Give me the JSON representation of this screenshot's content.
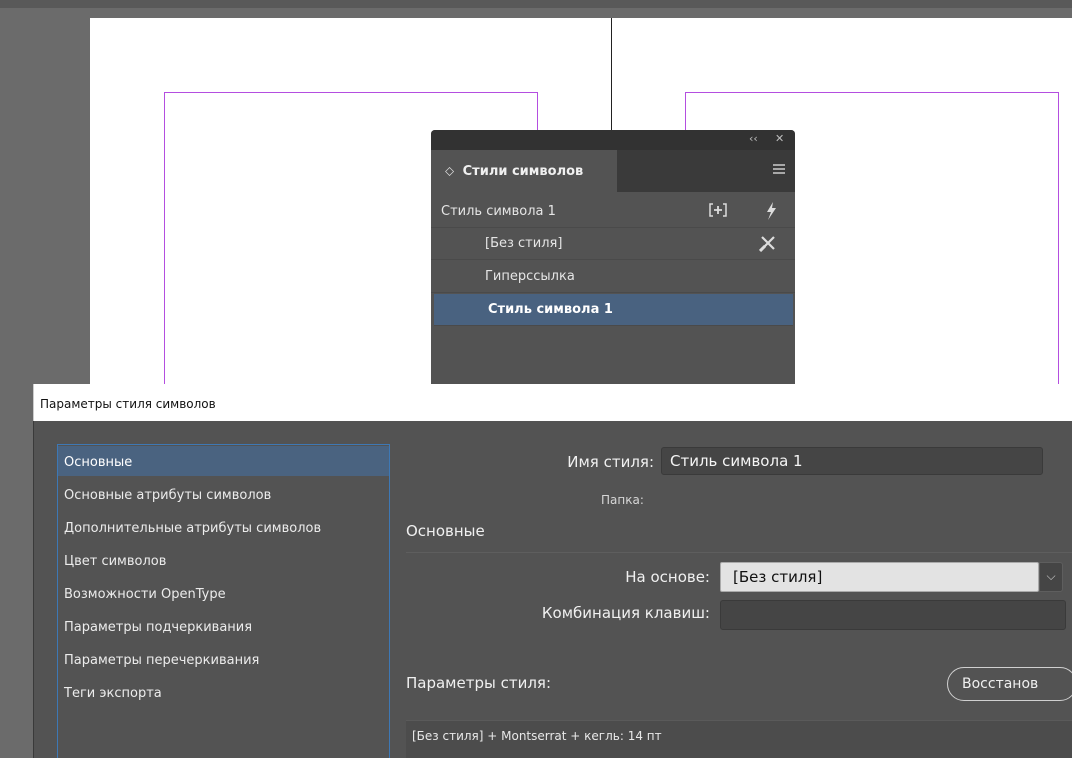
{
  "panel": {
    "controls": {
      "collapse": "‹‹",
      "close": "✕"
    },
    "tab_icon": "⬦",
    "title": "Стили символов",
    "current_style": "Стиль символа 1",
    "items": [
      "[Без стиля]",
      "Гиперссылка",
      "Стиль символа 1"
    ],
    "selected_index": 2,
    "icons": [
      "new-style-icon",
      "lightning-icon",
      "clear-override-icon",
      "panel-menu-icon"
    ]
  },
  "dialog": {
    "title": "Параметры стиля символов",
    "sidebar": [
      "Основные",
      "Основные атрибуты символов",
      "Дополнительные атрибуты символов",
      "Цвет символов",
      "Возможности OpenType",
      "Параметры подчеркивания",
      "Параметры перечеркивания",
      "Теги экспорта"
    ],
    "active_index": 0,
    "style_name_label": "Имя стиля:",
    "style_name_value": "Стиль символа 1",
    "folder_label": "Папка:",
    "section_title": "Основные",
    "based_on_label": "На основе:",
    "based_on_value": "[Без стиля]",
    "shortcut_label": "Комбинация клавиш:",
    "shortcut_value": "",
    "style_settings_label": "Параметры стиля:",
    "reset_button": "Восстанов",
    "style_settings_value": "[Без стиля] + Montserrat + кегль: 14 пт"
  },
  "colors": {
    "accent": "#496280",
    "margin_guide": "#b44ee0",
    "panel_bg": "#535353"
  }
}
